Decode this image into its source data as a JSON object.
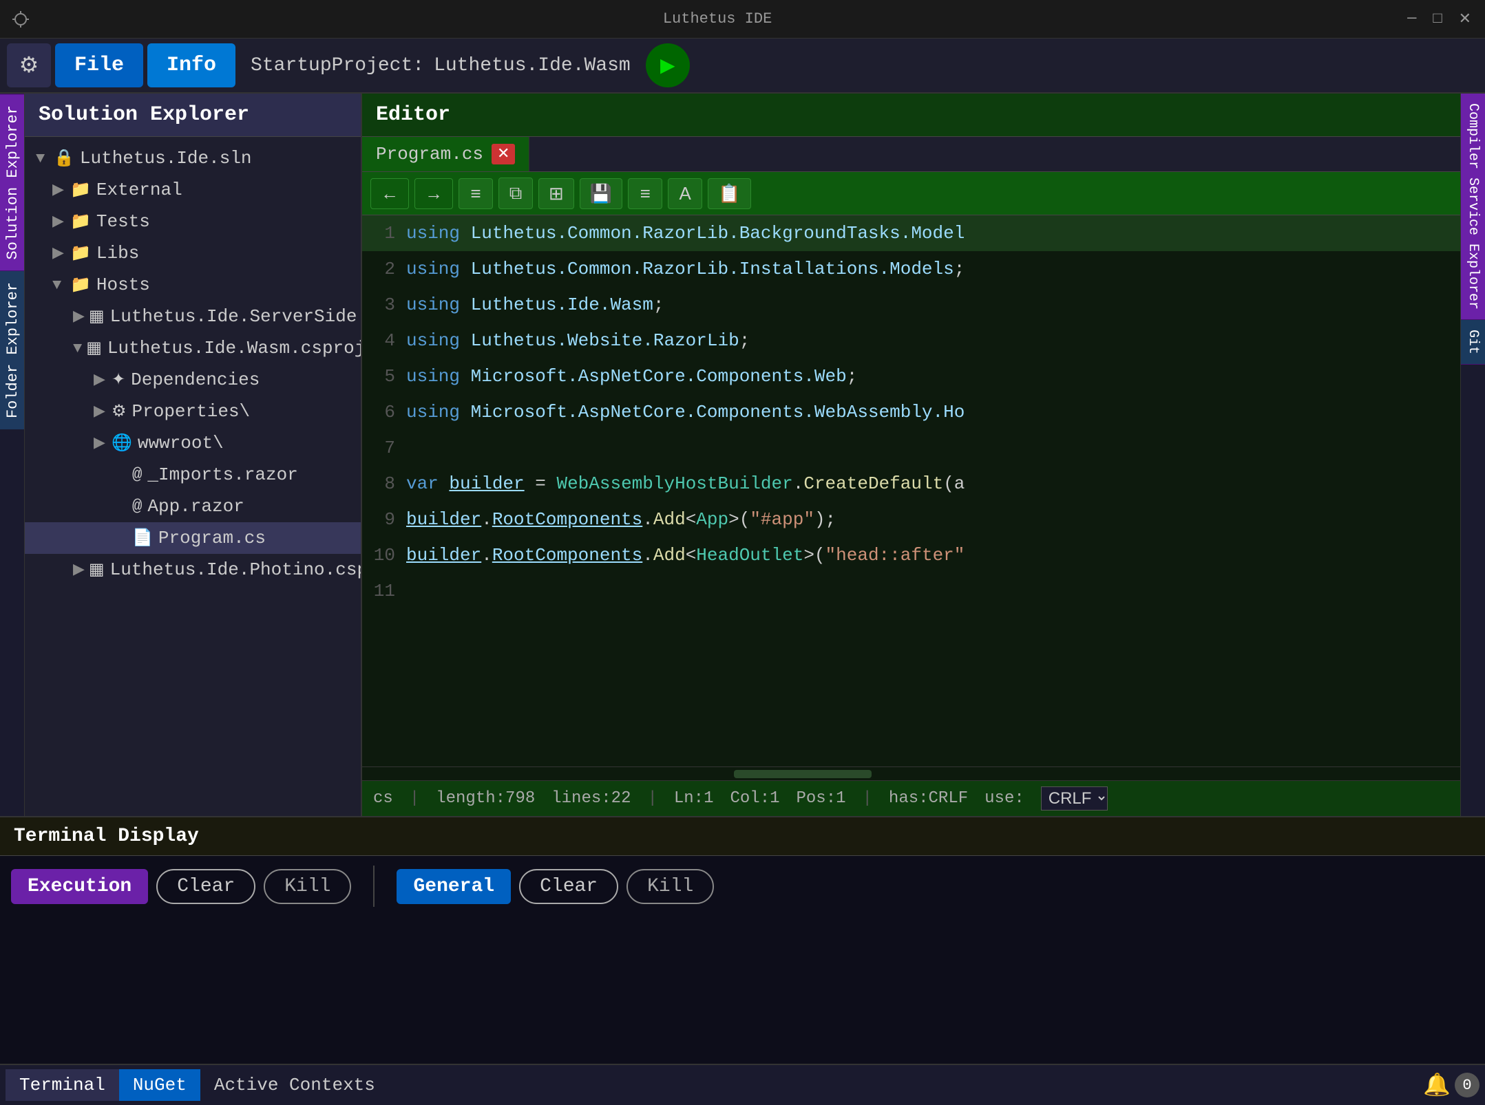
{
  "titlebar": {
    "app_name": "Luthetus IDE",
    "minimize": "─",
    "maximize": "□",
    "close": "✕"
  },
  "menubar": {
    "file_label": "File",
    "info_label": "Info",
    "startup_label": "StartupProject:",
    "startup_project": "Luthetus.Ide.Wasm",
    "run_icon": "▶"
  },
  "sidebar_tabs": [
    {
      "label": "Solution Explorer"
    },
    {
      "label": "Folder Explorer"
    }
  ],
  "solution_explorer": {
    "title": "Solution Explorer",
    "root": {
      "name": "Luthetus.Ide.sln",
      "children": [
        {
          "name": "External",
          "indent": 1
        },
        {
          "name": "Tests",
          "indent": 1
        },
        {
          "name": "Libs",
          "indent": 1
        },
        {
          "name": "Hosts",
          "indent": 1,
          "expanded": true,
          "children": [
            {
              "name": "Luthetus.Ide.ServerSide.csproj",
              "indent": 2
            },
            {
              "name": "Luthetus.Ide.Wasm.csproj",
              "indent": 2,
              "expanded": true,
              "children": [
                {
                  "name": "Dependencies",
                  "indent": 3
                },
                {
                  "name": "Properties\\",
                  "indent": 3
                },
                {
                  "name": "wwwroot\\",
                  "indent": 3
                },
                {
                  "name": "_Imports.razor",
                  "indent": 4
                },
                {
                  "name": "App.razor",
                  "indent": 4
                },
                {
                  "name": "Program.cs",
                  "indent": 4,
                  "selected": true
                }
              ]
            },
            {
              "name": "Luthetus.Ide.Photino.csproj",
              "indent": 2
            }
          ]
        }
      ]
    }
  },
  "editor": {
    "title": "Editor",
    "active_tab": "Program.cs",
    "toolbar_buttons": [
      "←",
      "→",
      "≡",
      "⧉",
      "⊞",
      "💾",
      "≡",
      "A",
      "📋"
    ],
    "lines": [
      {
        "num": 1,
        "content": "using Luthetus.Common.RazorLib.BackgroundTasks.Model"
      },
      {
        "num": 2,
        "content": "using Luthetus.Common.RazorLib.Installations.Models;"
      },
      {
        "num": 3,
        "content": "using Luthetus.Ide.Wasm;"
      },
      {
        "num": 4,
        "content": "using Luthetus.Website.RazorLib;"
      },
      {
        "num": 5,
        "content": "using Microsoft.AspNetCore.Components.Web;"
      },
      {
        "num": 6,
        "content": "using Microsoft.AspNetCore.Components.WebAssembly.Ho"
      },
      {
        "num": 7,
        "content": ""
      },
      {
        "num": 8,
        "content": "var builder = WebAssemblyHostBuilder.CreateDefault(a"
      },
      {
        "num": 9,
        "content": "builder.RootComponents.Add<App>(\"#app\");"
      },
      {
        "num": 10,
        "content": "builder.RootComponents.Add<HeadOutlet>(\"head::after\""
      },
      {
        "num": 11,
        "content": ""
      }
    ],
    "status": {
      "lang": "cs",
      "length": "length:798",
      "lines": "lines:22",
      "ln": "Ln:1",
      "col": "Col:1",
      "pos": "Pos:1",
      "has": "has:CRLF",
      "use": "use:",
      "crlf_option": "CRLF"
    }
  },
  "right_sidebar_tabs": [
    {
      "label": "Compiler Service Explorer"
    },
    {
      "label": "Git"
    }
  ],
  "terminal": {
    "title": "Terminal Display",
    "sections": [
      {
        "label": "Execution",
        "clear_btn": "Clear",
        "kill_btn": "Kill"
      },
      {
        "label": "General",
        "clear_btn": "Clear",
        "kill_btn": "Kill"
      }
    ]
  },
  "bottom_bar": {
    "tabs": [
      {
        "label": "Terminal",
        "active": true
      },
      {
        "label": "NuGet",
        "type": "nuget"
      },
      {
        "label": "Active Contexts"
      }
    ],
    "notification_count": "0"
  }
}
